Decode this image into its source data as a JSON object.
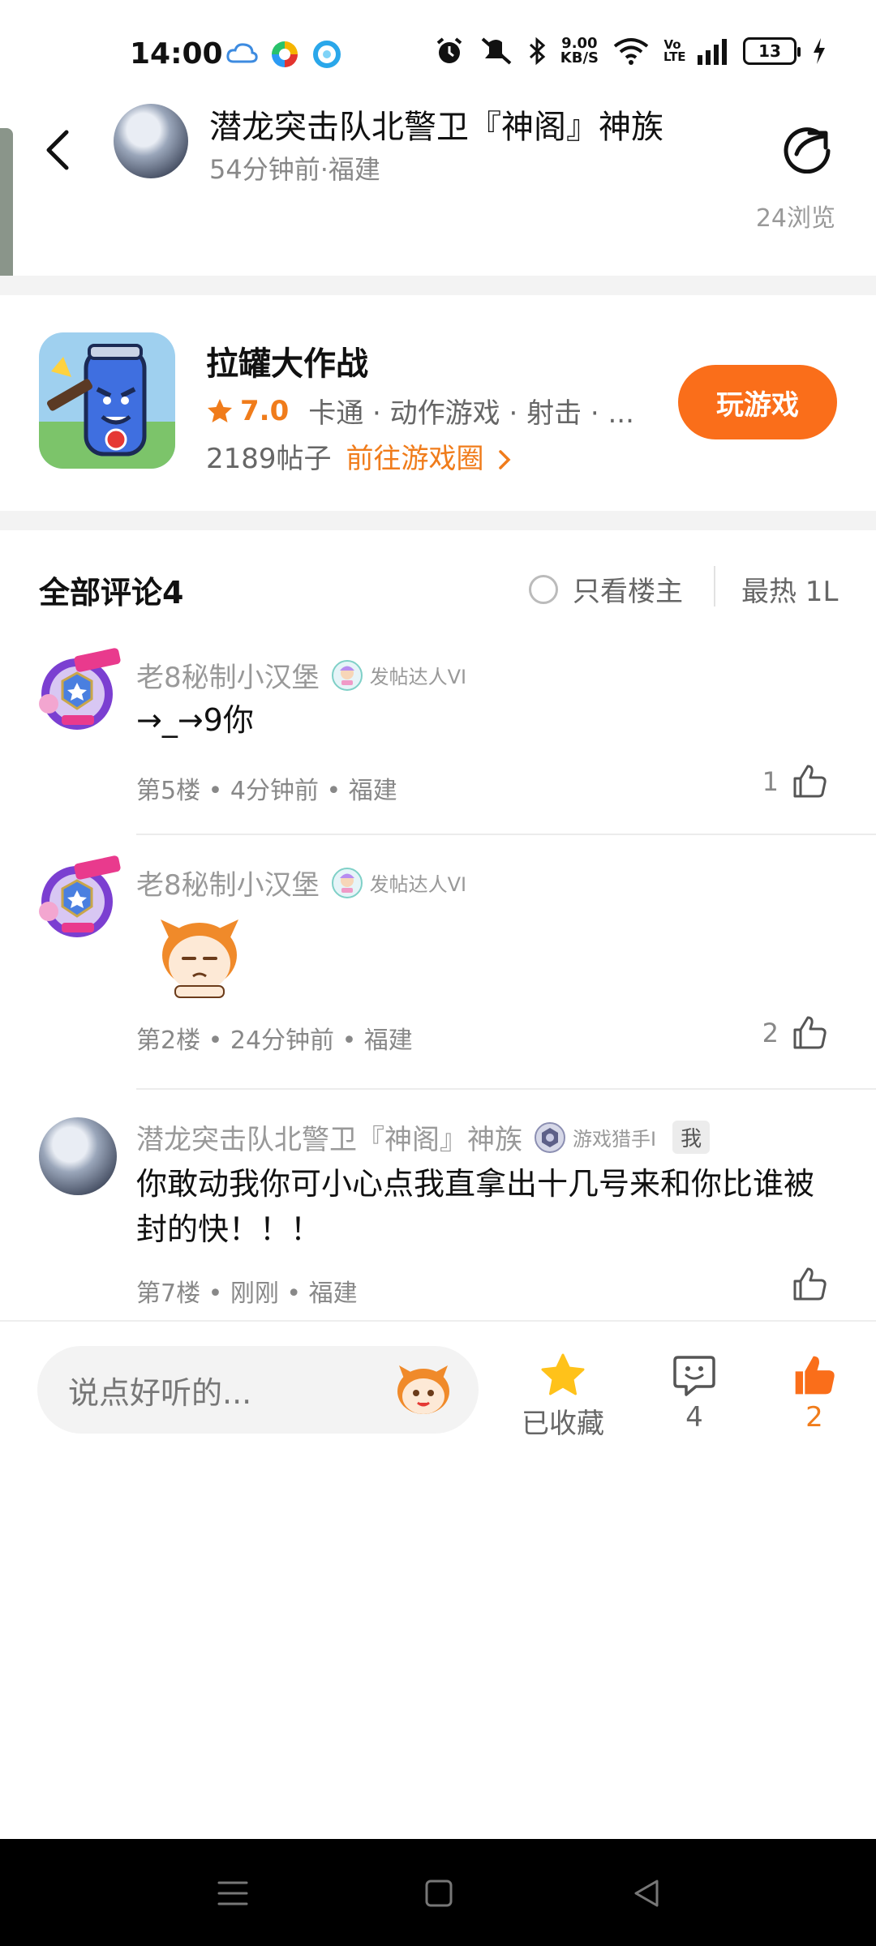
{
  "status_bar": {
    "time": "14:00",
    "net_speed_top": "9.00",
    "net_speed_bottom": "KB/S",
    "volte": "Vo LTE",
    "battery": "13",
    "icons": [
      "cloud-icon",
      "colorful-app-icon",
      "blue-app-icon",
      "alarm-icon",
      "mute-icon",
      "bluetooth-icon",
      "wifi-icon",
      "signal-icon",
      "charging-icon"
    ]
  },
  "header": {
    "title": "潜龙突击队北警卫『神阁』神族",
    "subtitle": "54分钟前·福建",
    "views": "24浏览"
  },
  "game": {
    "name": "拉罐大作战",
    "rating": "7.0",
    "tags": "卡通 · 动作游戏 · 射击 · ...",
    "posts": "2189帖子",
    "goto": "前往游戏圈",
    "play_label": "玩游戏"
  },
  "comments_header": {
    "title": "全部评论4",
    "only_op": "只看楼主",
    "sort": "最热 1L"
  },
  "comments": [
    {
      "user": "老8秘制小汉堡",
      "badge": "发帖达人VI",
      "text": "→_→9你",
      "meta": "第5楼 • 4分钟前 • 福建",
      "likes": "1"
    },
    {
      "user": "老8秘制小汉堡",
      "badge": "发帖达人VI",
      "text": "",
      "meta": "第2楼 • 24分钟前 • 福建",
      "likes": "2"
    },
    {
      "user": "潜龙突击队北警卫『神阁』神族",
      "badge": "游戏猎手I",
      "me": "我",
      "text": "你敢动我你可小心点我直拿出十几号来和你比谁被封的快！！！",
      "meta": "第7楼 • 刚刚 • 福建",
      "likes": ""
    }
  ],
  "bottom_bar": {
    "input_placeholder": "说点好听的...",
    "favorite_label": "已收藏",
    "comment_count": "4",
    "like_count": "2"
  },
  "colors": {
    "accent": "#fa6e1a",
    "accent_text": "#f07c1b",
    "star": "#ffc21a"
  }
}
